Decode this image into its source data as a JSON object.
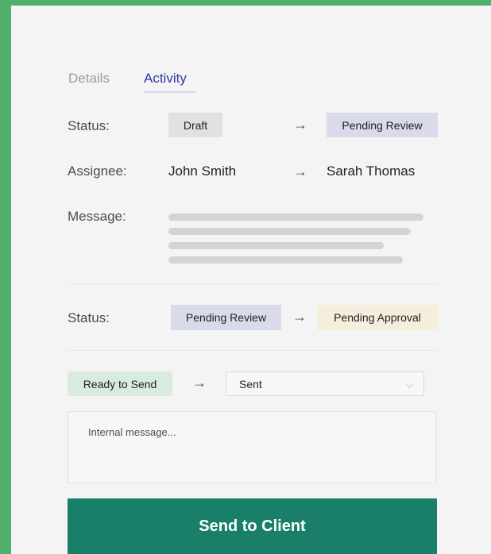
{
  "tabs": {
    "details": "Details",
    "activity": "Activity"
  },
  "arrow": "→",
  "entry1": {
    "status_label": "Status:",
    "status_from": "Draft",
    "status_to": "Pending Review",
    "assignee_label": "Assignee:",
    "assignee_from": "John Smith",
    "assignee_to": "Sarah Thomas",
    "message_label": "Message:"
  },
  "entry2": {
    "status_label": "Status:",
    "status_from": "Pending Review",
    "status_to": "Pending Approval"
  },
  "compose": {
    "current_status": "Ready to Send",
    "next_status": "Sent",
    "message_placeholder": "Internal message...",
    "send_button": "Send to Client"
  },
  "colors": {
    "accent": "#2e37a8",
    "primary_button": "#1a7f69",
    "background": "#4faf6c"
  }
}
